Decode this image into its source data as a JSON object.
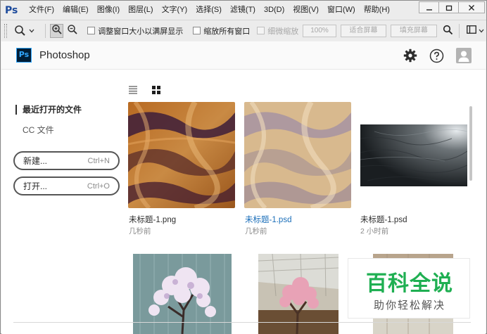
{
  "menubar": {
    "logo": "Ps",
    "items": [
      "文件(F)",
      "编辑(E)",
      "图像(I)",
      "图层(L)",
      "文字(Y)",
      "选择(S)",
      "滤镜(T)",
      "3D(D)",
      "视图(V)",
      "窗口(W)",
      "帮助(H)"
    ],
    "window_controls": [
      "minimize-icon",
      "restore-icon",
      "close-icon"
    ]
  },
  "options": {
    "resize_windows": "调整窗口大小以满屏显示",
    "zoom_all": "缩放所有窗口",
    "scrubby_zoom": "细微缩放",
    "btn_100": "100%",
    "btn_fit": "适合屏幕",
    "btn_fill": "填充屏幕"
  },
  "header": {
    "logo_text": "Ps",
    "app_name": "Photoshop",
    "icons": [
      "gear-icon",
      "help-icon",
      "user-avatar-icon"
    ]
  },
  "sidebar": {
    "recent": "最近打开的文件",
    "cc_files": "CC 文件",
    "new_label": "新建...",
    "new_shortcut": "Ctrl+N",
    "open_label": "打开...",
    "open_shortcut": "Ctrl+O"
  },
  "files": [
    {
      "name": "未标题-1.png",
      "time": "几秒前"
    },
    {
      "name": "未标题-1.psd",
      "time": "几秒前"
    },
    {
      "name": "未标题-1.psd",
      "time": "2 小时前"
    }
  ],
  "watermark": {
    "title": "百科全说",
    "subtitle": "助你轻松解决"
  },
  "colors": {
    "accent_blue": "#1a6eb9",
    "ps_blue": "#31a8ff",
    "ps_dark": "#001e36",
    "watermark_green": "#1faf52"
  }
}
